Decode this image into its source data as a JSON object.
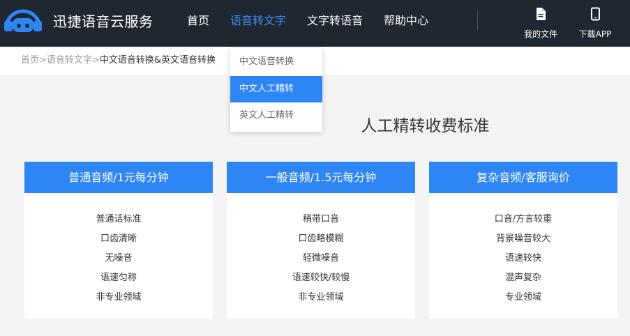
{
  "header": {
    "brand": "迅捷语音云服务",
    "logo_icon": "headphones-logo-icon",
    "nav": [
      {
        "label": "首页",
        "active": false
      },
      {
        "label": "语音转文字",
        "active": true
      },
      {
        "label": "文字转语音",
        "active": false
      },
      {
        "label": "帮助中心",
        "active": false
      }
    ],
    "tools": [
      {
        "label": "我的文件",
        "icon": "document-icon"
      },
      {
        "label": "下载APP",
        "icon": "phone-icon"
      }
    ]
  },
  "breadcrumb": {
    "home": "首页",
    "sep1": ">",
    "section": "语音转文字",
    "sep2": ">",
    "current": "中文语音转换&英文语音转换"
  },
  "dropdown": {
    "items": [
      {
        "label": "中文语音转换",
        "selected": false
      },
      {
        "label": "中文人工精转",
        "selected": true
      },
      {
        "label": "英文人工精转",
        "selected": false
      }
    ]
  },
  "page": {
    "title": "人工精转收费标准"
  },
  "pricing": [
    {
      "title": "普通音频/1元每分钟",
      "features": [
        "普通话标准",
        "口齿清晰",
        "无噪音",
        "语速匀称",
        "非专业领域"
      ]
    },
    {
      "title": "一般音频/1.5元每分钟",
      "features": [
        "稍带口音",
        "口齿略模糊",
        "轻微噪音",
        "语速较快/较慢",
        "非专业领域"
      ]
    },
    {
      "title": "复杂音频/客服询价",
      "features": [
        "口音/方言较重",
        "背景噪音较大",
        "语速较快",
        "混声复杂",
        "专业领域"
      ]
    }
  ],
  "colors": {
    "header_bg": "#1f2731",
    "accent": "#2e86f4",
    "nav_active": "#3d8cf3",
    "page_bg": "#f4f4f4"
  }
}
